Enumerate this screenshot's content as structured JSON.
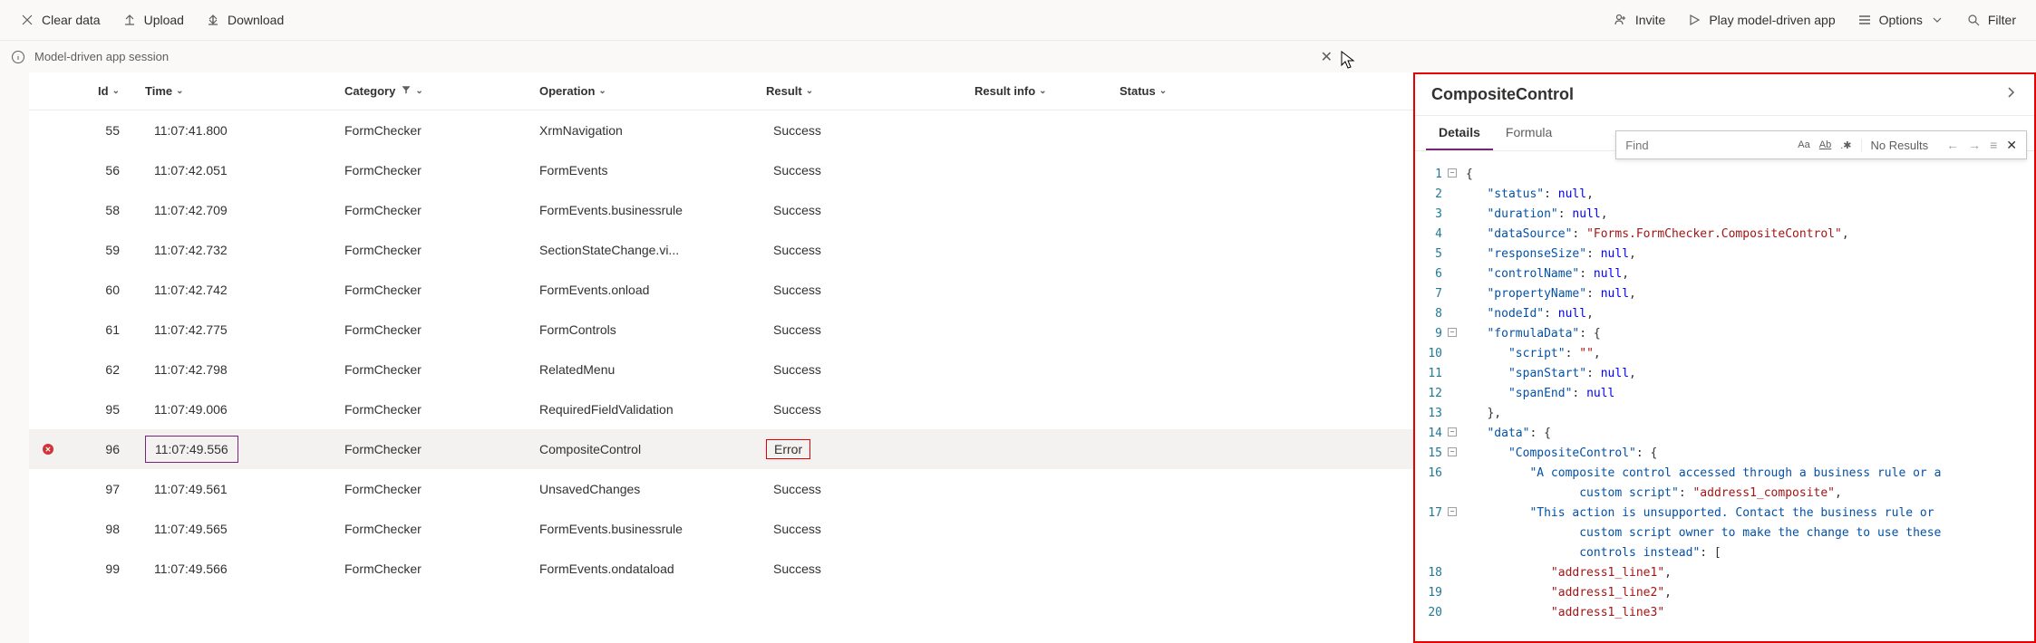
{
  "toolbar": {
    "clear": "Clear data",
    "upload": "Upload",
    "download": "Download",
    "invite": "Invite",
    "play": "Play model-driven app",
    "options": "Options",
    "filter": "Filter"
  },
  "session": {
    "label": "Model-driven app session"
  },
  "table": {
    "headers": {
      "id": "Id",
      "time": "Time",
      "category": "Category",
      "operation": "Operation",
      "result": "Result",
      "resultInfo": "Result info",
      "status": "Status"
    },
    "rows": [
      {
        "id": "55",
        "time": "11:07:41.800",
        "category": "FormChecker",
        "operation": "XrmNavigation",
        "result": "Success",
        "error": false
      },
      {
        "id": "56",
        "time": "11:07:42.051",
        "category": "FormChecker",
        "operation": "FormEvents",
        "result": "Success",
        "error": false
      },
      {
        "id": "58",
        "time": "11:07:42.709",
        "category": "FormChecker",
        "operation": "FormEvents.businessrule",
        "result": "Success",
        "error": false
      },
      {
        "id": "59",
        "time": "11:07:42.732",
        "category": "FormChecker",
        "operation": "SectionStateChange.vi...",
        "result": "Success",
        "error": false
      },
      {
        "id": "60",
        "time": "11:07:42.742",
        "category": "FormChecker",
        "operation": "FormEvents.onload",
        "result": "Success",
        "error": false
      },
      {
        "id": "61",
        "time": "11:07:42.775",
        "category": "FormChecker",
        "operation": "FormControls",
        "result": "Success",
        "error": false
      },
      {
        "id": "62",
        "time": "11:07:42.798",
        "category": "FormChecker",
        "operation": "RelatedMenu",
        "result": "Success",
        "error": false
      },
      {
        "id": "95",
        "time": "11:07:49.006",
        "category": "FormChecker",
        "operation": "RequiredFieldValidation",
        "result": "Success",
        "error": false
      },
      {
        "id": "96",
        "time": "11:07:49.556",
        "category": "FormChecker",
        "operation": "CompositeControl",
        "result": "Error",
        "error": true,
        "selected": true
      },
      {
        "id": "97",
        "time": "11:07:49.561",
        "category": "FormChecker",
        "operation": "UnsavedChanges",
        "result": "Success",
        "error": false
      },
      {
        "id": "98",
        "time": "11:07:49.565",
        "category": "FormChecker",
        "operation": "FormEvents.businessrule",
        "result": "Success",
        "error": false
      },
      {
        "id": "99",
        "time": "11:07:49.566",
        "category": "FormChecker",
        "operation": "FormEvents.ondataload",
        "result": "Success",
        "error": false
      }
    ]
  },
  "panel": {
    "title": "CompositeControl",
    "tabs": {
      "details": "Details",
      "formula": "Formula"
    },
    "find": {
      "placeholder": "Find",
      "results": "No Results"
    },
    "code": [
      {
        "n": 1,
        "fold": "-",
        "html": "{"
      },
      {
        "n": 2,
        "html": "   <span class='tok-key'>\"status\"</span>: <span class='tok-null'>null</span>,"
      },
      {
        "n": 3,
        "html": "   <span class='tok-key'>\"duration\"</span>: <span class='tok-null'>null</span>,"
      },
      {
        "n": 4,
        "html": "   <span class='tok-key'>\"dataSource\"</span>: <span class='tok-str'>\"Forms.FormChecker.CompositeControl\"</span>,"
      },
      {
        "n": 5,
        "html": "   <span class='tok-key'>\"responseSize\"</span>: <span class='tok-null'>null</span>,"
      },
      {
        "n": 6,
        "html": "   <span class='tok-key'>\"controlName\"</span>: <span class='tok-null'>null</span>,"
      },
      {
        "n": 7,
        "html": "   <span class='tok-key'>\"propertyName\"</span>: <span class='tok-null'>null</span>,"
      },
      {
        "n": 8,
        "html": "   <span class='tok-key'>\"nodeId\"</span>: <span class='tok-null'>null</span>,"
      },
      {
        "n": 9,
        "fold": "-",
        "html": "   <span class='tok-key'>\"formulaData\"</span>: {"
      },
      {
        "n": 10,
        "html": "      <span class='tok-key'>\"script\"</span>: <span class='tok-str'>\"\"</span>,"
      },
      {
        "n": 11,
        "html": "      <span class='tok-key'>\"spanStart\"</span>: <span class='tok-null'>null</span>,"
      },
      {
        "n": 12,
        "html": "      <span class='tok-key'>\"spanEnd\"</span>: <span class='tok-null'>null</span>"
      },
      {
        "n": 13,
        "html": "   },"
      },
      {
        "n": 14,
        "fold": "-",
        "html": "   <span class='tok-key'>\"data\"</span>: {"
      },
      {
        "n": 15,
        "fold": "-",
        "html": "      <span class='tok-key'>\"CompositeControl\"</span>: {"
      },
      {
        "n": 16,
        "html": "         <span class='tok-key'>\"A composite control accessed through a business rule or a<br>                custom script\"</span>: <span class='tok-str'>\"address1_composite\"</span>,"
      },
      {
        "n": 17,
        "fold": "-",
        "html": "         <span class='tok-key'>\"This action is unsupported. Contact the business rule or<br>                custom script owner to make the change to use these<br>                controls instead\"</span>: ["
      },
      {
        "n": 18,
        "html": "            <span class='tok-str'>\"address1_line1\"</span>,"
      },
      {
        "n": 19,
        "html": "            <span class='tok-str'>\"address1_line2\"</span>,"
      },
      {
        "n": 20,
        "html": "            <span class='tok-str'>\"address1_line3\"</span>"
      }
    ]
  }
}
